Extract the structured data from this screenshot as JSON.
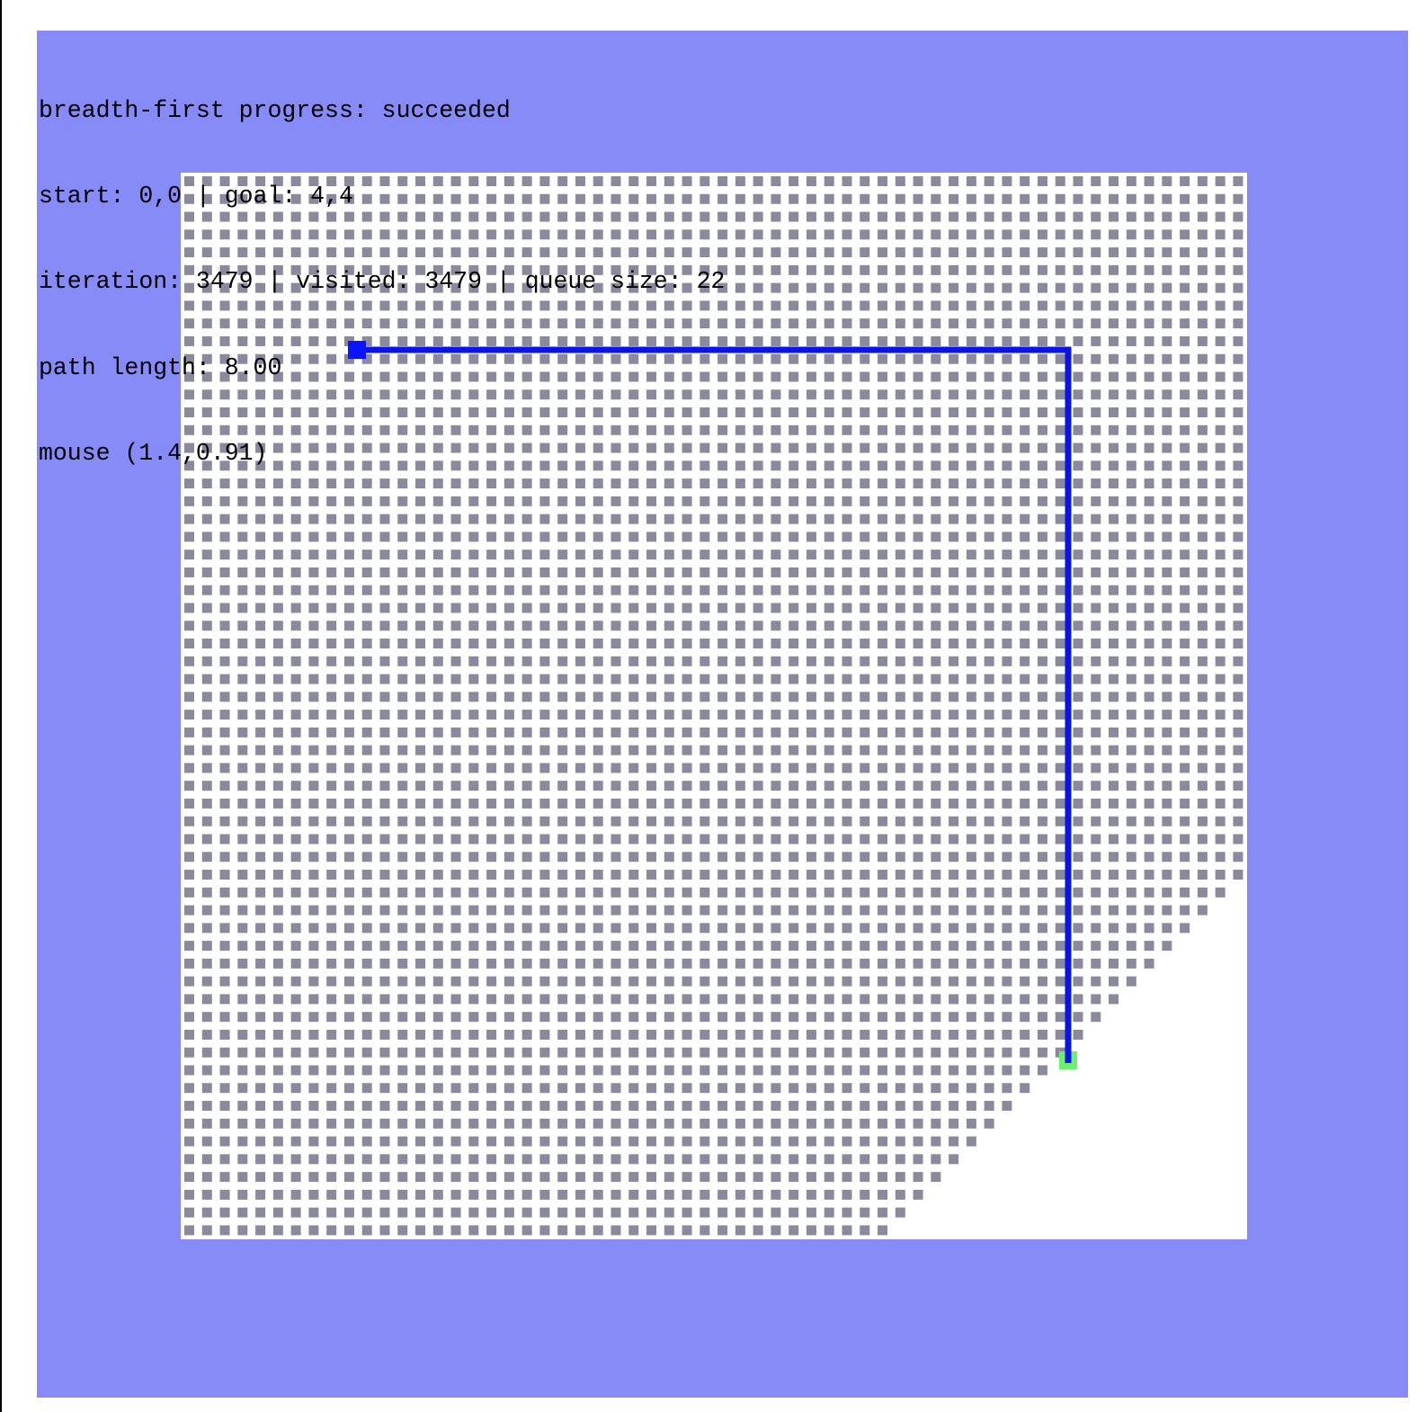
{
  "app": {
    "algorithm": "breadth-first",
    "status_line": "breadth-first progress: succeeded",
    "start_goal_line": "start: 0,0 | goal: 4,4",
    "stats_line": "iteration: 3479 | visited: 3479 | queue size: 22",
    "path_line": "path length: 8.00",
    "mouse_line": "mouse (1.4,0.91)"
  },
  "search": {
    "status": "succeeded",
    "start": [
      0,
      0
    ],
    "goal": [
      4,
      4
    ],
    "iteration": 3479,
    "visited": 3479,
    "queue_size": 22,
    "path_length": 8.0,
    "mouse": [
      1.4,
      0.91
    ]
  },
  "colors": {
    "background": "#878bf7",
    "grid_area": "#ffffff",
    "visited_cell": "#8a8a9c",
    "path": "#0a14e6",
    "start_marker": "#0a14ff",
    "goal_marker": "#6ef06e"
  },
  "icons": {
    "start": "start-marker-icon",
    "goal": "goal-marker-icon"
  }
}
